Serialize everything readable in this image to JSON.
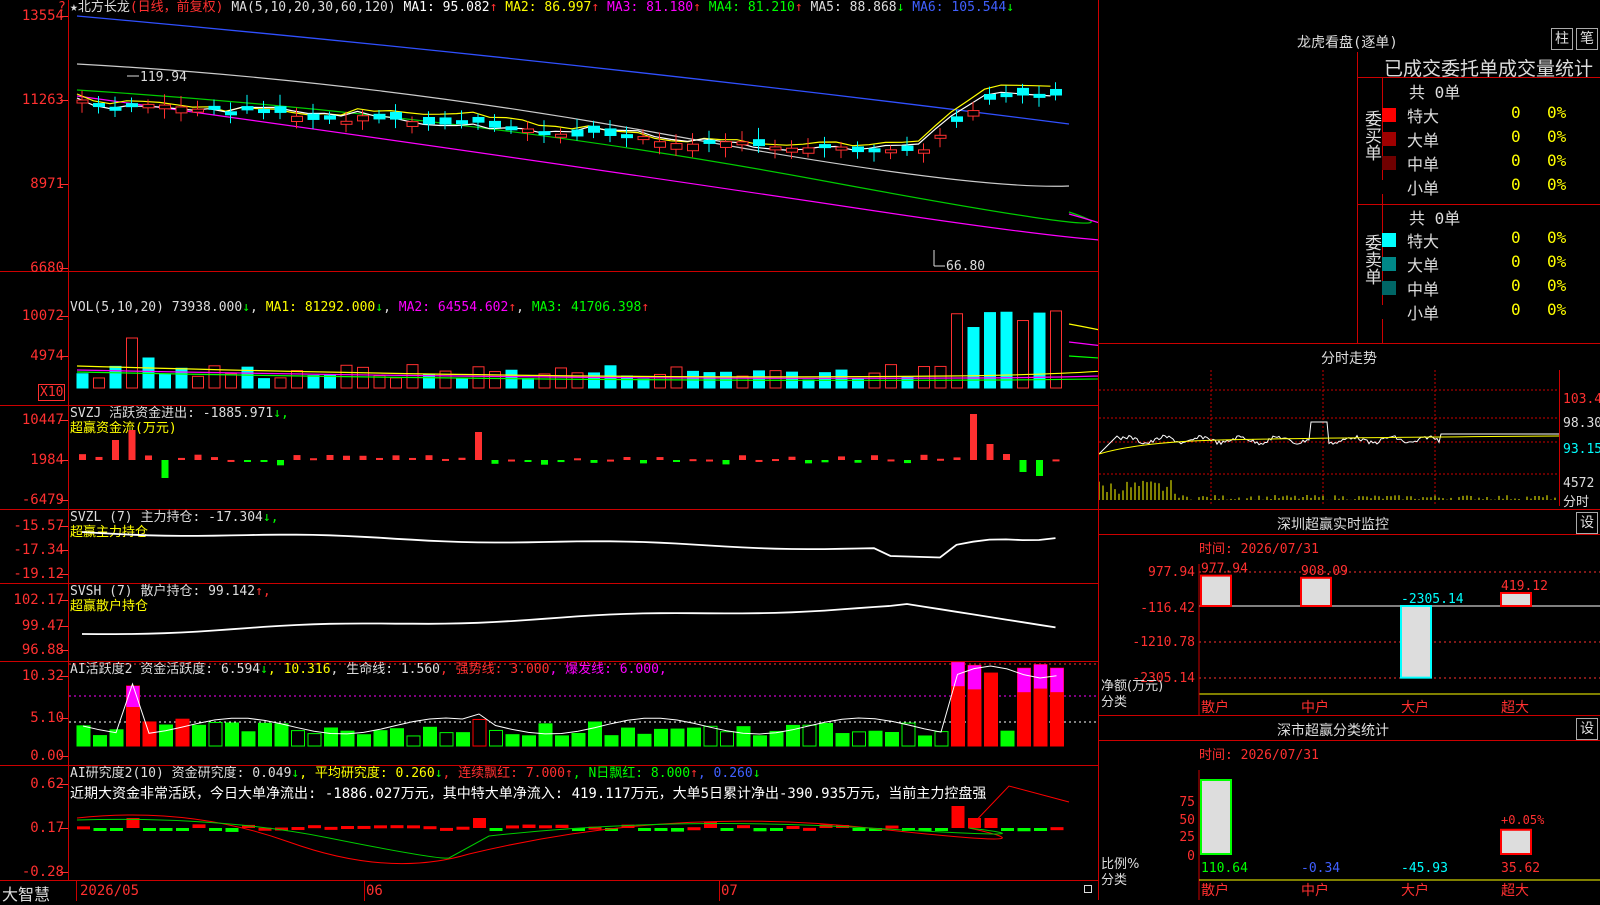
{
  "app": {
    "brand": "大智慧"
  },
  "main": {
    "star": "★",
    "stock_name": "北方长龙",
    "mode": "(日线，前复权)",
    "ma_label": "MA(5,10,20,30,60,120)",
    "ma": [
      {
        "label": "MA1:",
        "value": "95.082",
        "arrow": "↑",
        "color": "#ffffff"
      },
      {
        "label": "MA2:",
        "value": "86.997",
        "arrow": "↑",
        "color": "#ffff00"
      },
      {
        "label": "MA3:",
        "value": "81.180",
        "arrow": "↑",
        "color": "#ff00ff"
      },
      {
        "label": "MA4:",
        "value": "81.210",
        "arrow": "↑",
        "color": "#00ff00"
      },
      {
        "label": "MA5:",
        "value": "88.868",
        "arrow": "↓",
        "color": "#dddddd"
      },
      {
        "label": "MA6:",
        "value": "105.544",
        "arrow": "↓",
        "color": "#4060ff"
      }
    ],
    "yticks": [
      "13554",
      "11263",
      "8971",
      "6680"
    ],
    "top_marker": "?",
    "high_label": "119.94",
    "low_label": "66.80"
  },
  "vol": {
    "label": "VOL(5,10,20)",
    "value": "73938.000",
    "value_arrow": "↓",
    "ma1": "MA1: 81292.000",
    "ma1_arrow": "↓",
    "ma2": "MA2: 64554.602",
    "ma2_arrow": "↑",
    "ma3": "MA3: 41706.398",
    "ma3_arrow": "↑",
    "yticks": [
      "10072",
      "4974"
    ],
    "unit": "X10"
  },
  "svzj": {
    "line1": "SVZJ  活跃资金进出: -1885.971",
    "line1_arrow": "↓,",
    "line2": "超赢资金流(万元)",
    "yticks": [
      "10447",
      "1984",
      "-6479"
    ]
  },
  "svzl": {
    "line1": "SVZL (7) 主力持仓: -17.304",
    "line1_arrow": "↓,",
    "line2": "超赢主力持仓",
    "yticks": [
      "-15.57",
      "-17.34",
      "-19.12"
    ]
  },
  "svsh": {
    "line1": "SVSH (7) 散户持仓: 99.142",
    "line1_arrow": "↑,",
    "line2": "超赢散户持仓",
    "yticks": [
      "102.17",
      "99.47",
      "96.88"
    ]
  },
  "ai1": {
    "label": "AI活跃度2 资金活跃度: 6.594",
    "a1": "↓",
    "b": ", 10.316",
    "c": ", 生命线: 1.560",
    "d": ", 强势线: 3.000",
    "e": ", 爆发线: 6.000,",
    "yticks": [
      "10.32",
      "5.10",
      "0.00"
    ]
  },
  "ai2": {
    "label": "AI研究度2(10) 资金研究度: 0.049",
    "a1": "↓",
    "b": ", 平均研究度: 0.260",
    "b1": "↓",
    "c": ", 连续飘红: 7.000",
    "c1": "↑",
    "d": ", N日飘红: 8.000",
    "d1": "↑",
    "e": ", 0.260",
    "e1": "↓",
    "summary": "近期大资金非常活跃，今日大单净流出: -1886.027万元，其中特大单净流入: 419.117万元，大单5日累计净出-390.935万元，当前主力控盘强",
    "yticks": [
      "0.62",
      "0.17",
      "-0.28"
    ]
  },
  "xaxis": [
    "2026/05",
    "06",
    "07"
  ],
  "right": {
    "longhu": {
      "title": "龙虎看盘(逐单)",
      "btn1": "柱",
      "btn2": "笔",
      "subtitle": "已成交委托单成交量统计"
    },
    "buy": {
      "side": "委买单",
      "total": "共 0单",
      "rows": [
        {
          "label": "特大",
          "value": "0",
          "pct": "0%",
          "color": "#ff0000"
        },
        {
          "label": "大单",
          "value": "0",
          "pct": "0%",
          "color": "#a00000"
        },
        {
          "label": "中单",
          "value": "0",
          "pct": "0%",
          "color": "#700000"
        },
        {
          "label": "小单",
          "value": "0",
          "pct": "0%",
          "color": "#000000"
        }
      ]
    },
    "sell": {
      "side": "委卖单",
      "total": "共 0单",
      "rows": [
        {
          "label": "特大",
          "value": "0",
          "pct": "0%",
          "color": "#00ffff"
        },
        {
          "label": "大单",
          "value": "0",
          "pct": "0%",
          "color": "#008888"
        },
        {
          "label": "中单",
          "value": "0",
          "pct": "0%",
          "color": "#006666"
        },
        {
          "label": "小单",
          "value": "0",
          "pct": "0%",
          "color": "#000000"
        }
      ]
    },
    "intraday": {
      "title": "分时走势",
      "yticks": [
        "103.4",
        "98.30",
        "93.15",
        "4572"
      ],
      "unit": "分时"
    },
    "monitor": {
      "title": "深圳超赢实时监控",
      "btn": "设",
      "time": "时间: 2026/07/31",
      "yticks": [
        "977.94",
        "-116.42",
        "-1210.78",
        "-2305.14"
      ],
      "bars": [
        {
          "name": "散户",
          "value": "977.94"
        },
        {
          "name": "中户",
          "value": "908.09"
        },
        {
          "name": "大户",
          "value": "-2305.14"
        },
        {
          "name": "超大",
          "value": "419.12"
        }
      ],
      "ylabel1": "净额(万元)",
      "ylabel2": "分类"
    },
    "classify": {
      "title": "深市超赢分类统计",
      "btn": "设",
      "time": "时间: 2026/07/31",
      "yticks": [
        "75",
        "50",
        "25",
        "0"
      ],
      "bars": [
        {
          "name": "散户",
          "value": "110.64"
        },
        {
          "name": "中户",
          "value": "-0.34"
        },
        {
          "name": "大户",
          "value": "-45.93"
        },
        {
          "name": "超大",
          "value": "35.62"
        }
      ],
      "extra": "+0.05%",
      "ylabel1": "比例%",
      "ylabel2": "分类"
    }
  }
}
